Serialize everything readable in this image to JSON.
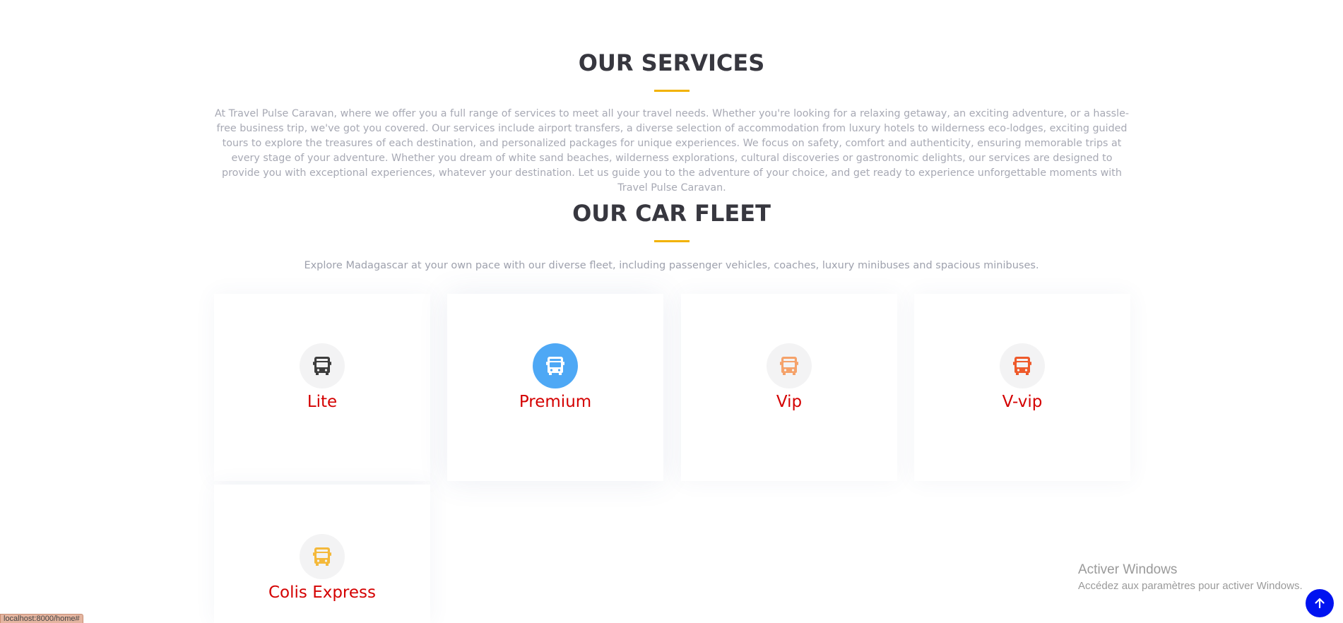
{
  "services": {
    "title": "OUR SERVICES",
    "description": "At Travel Pulse Caravan, where we offer you a full range of services to meet all your travel needs. Whether you're looking for a relaxing getaway, an exciting adventure, or a hassle-free business trip, we've got you covered. Our services include airport transfers, a diverse selection of accommodation from luxury hotels to wilderness eco-lodges, exciting guided tours to explore the treasures of each destination, and personalized packages for unique experiences. We focus on safety, comfort and authenticity, ensuring memorable trips at every stage of your adventure. Whether you dream of white sand beaches, wilderness explorations, cultural discoveries or gastronomic delights, our services are designed to provide you with exceptional experiences, whatever your destination. Let us guide you to the adventure of your choice, and get ready to experience unforgettable moments with Travel Pulse Caravan."
  },
  "fleet": {
    "title": "OUR CAR FLEET",
    "description": "Explore Madagascar at your own pace with our diverse fleet, including passenger vehicles, coaches, luxury minibuses and spacious minibuses.",
    "cards": [
      {
        "label": "Lite",
        "icon": "bus-icon",
        "icon_color": "#3d3d3d"
      },
      {
        "label": "Premium",
        "icon": "bus-icon",
        "icon_color": "#ffffff",
        "circle_color": "#4ea8f5"
      },
      {
        "label": "Vip",
        "icon": "bus-icon",
        "icon_color": "#f5a26a"
      },
      {
        "label": "V-vip",
        "icon": "bus-icon",
        "icon_color": "#ee5a2b"
      },
      {
        "label": "Colis Express",
        "icon": "bus-icon",
        "icon_color": "#f4b93b"
      }
    ]
  },
  "windows_watermark": {
    "line1": "Activer Windows",
    "line2": "Accédez aux paramètres pour activer Windows."
  },
  "back_to_top": {
    "icon": "arrow-up-icon",
    "color": "#0013f0"
  },
  "status_bar": {
    "url": "localhost:8000/home#"
  },
  "colors": {
    "accent": "#f2b200",
    "card_title": "#d40000",
    "heading": "#37373f"
  }
}
